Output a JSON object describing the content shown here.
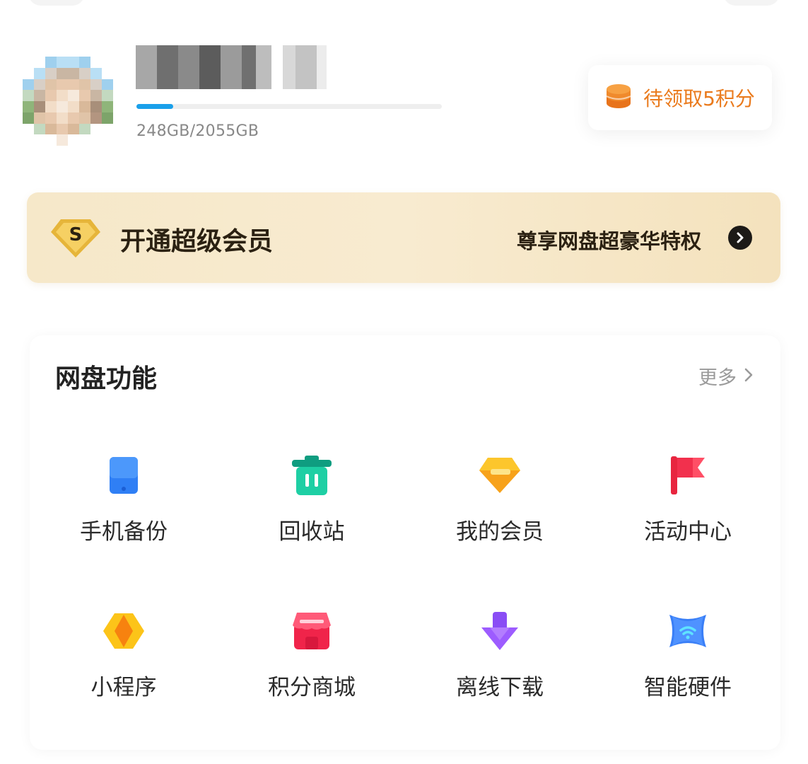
{
  "profile": {
    "storage_text": "248GB/2055GB",
    "storage_used_fraction": 0.12,
    "points_label": "待领取5积分",
    "points_icon": "coin-stack-icon"
  },
  "vip_banner": {
    "title": "开通超级会员",
    "subtitle": "尊享网盘超豪华特权",
    "badge_icon": "super-vip-diamond-icon",
    "arrow_icon": "chevron-right-circle-icon"
  },
  "features": {
    "title": "网盘功能",
    "more_label": "更多",
    "items": [
      {
        "label": "手机备份",
        "icon": "phone-backup-icon"
      },
      {
        "label": "回收站",
        "icon": "trash-bin-icon"
      },
      {
        "label": "我的会员",
        "icon": "diamond-icon"
      },
      {
        "label": "活动中心",
        "icon": "flag-icon"
      },
      {
        "label": "小程序",
        "icon": "mini-program-icon"
      },
      {
        "label": "积分商城",
        "icon": "store-icon"
      },
      {
        "label": "离线下载",
        "icon": "download-arrow-icon"
      },
      {
        "label": "智能硬件",
        "icon": "smart-hardware-icon"
      }
    ]
  },
  "colors": {
    "accent_orange": "#ea7a1c",
    "progress_blue": "#1aa0ea",
    "vip_gold": "#f6e8c9"
  }
}
